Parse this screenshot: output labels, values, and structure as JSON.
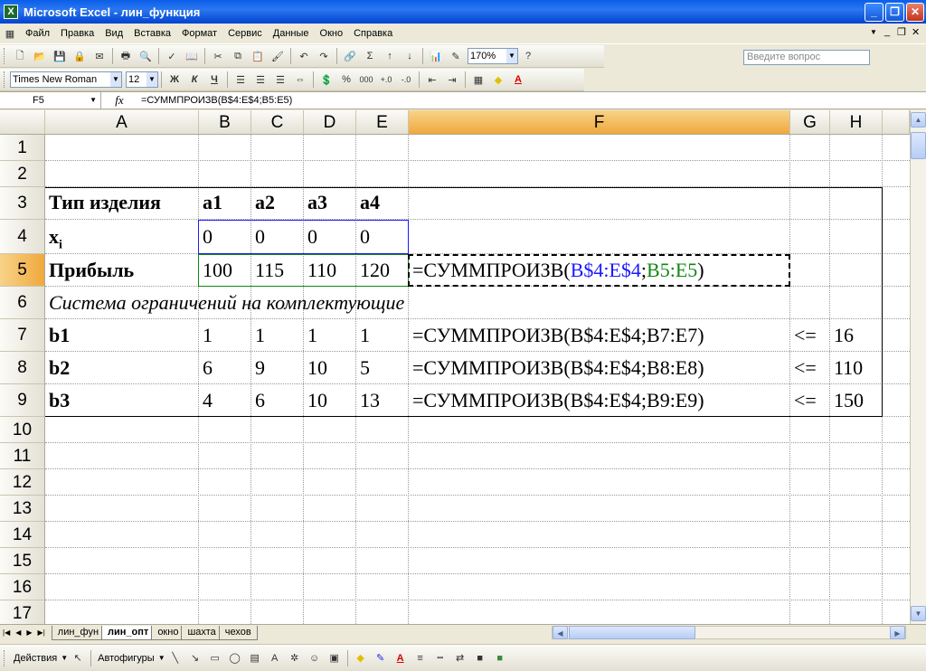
{
  "window": {
    "title": "Microsoft Excel - лин_функция",
    "logo": "X"
  },
  "menu": [
    "Файл",
    "Правка",
    "Вид",
    "Вставка",
    "Формат",
    "Сервис",
    "Данные",
    "Окно",
    "Справка"
  ],
  "ask_placeholder": "Введите вопрос",
  "standard_toolbar": {
    "zoom": "170%"
  },
  "format_toolbar": {
    "font": "Times New Roman",
    "size": "12",
    "bold": "Ж",
    "italic": "К",
    "underline": "Ч",
    "percent": "%",
    "thousands": "000"
  },
  "formula_bar": {
    "name_box": "F5",
    "fx": "fx",
    "formula": "=СУММПРОИЗВ(B$4:E$4;B5:E5)"
  },
  "columns": [
    "A",
    "B",
    "C",
    "D",
    "E",
    "F",
    "G",
    "H"
  ],
  "rows": [
    "1",
    "2",
    "3",
    "4",
    "5",
    "6",
    "7",
    "8",
    "9",
    "10",
    "11",
    "12",
    "13",
    "14",
    "15",
    "16",
    "17"
  ],
  "cells": {
    "A3": "Тип изделия",
    "B3": "a1",
    "C3": "a2",
    "D3": "a3",
    "E3": "a4",
    "A4": "x",
    "A4_sub": "i",
    "B4": "0",
    "C4": "0",
    "D4": "0",
    "E4": "0",
    "A5": "Прибыль",
    "B5": "100",
    "C5": "115",
    "D5": "110",
    "E5": "120",
    "F5_a": "=СУММПРОИЗВ(",
    "F5_b": "B$4:E$4",
    "F5_c": ";",
    "F5_d": "B5:E5",
    "F5_e": ")",
    "A6": "Система ограничений на комплектующие",
    "A7": "b1",
    "B7": "1",
    "C7": "1",
    "D7": "1",
    "E7": "1",
    "F7": "=СУММПРОИЗВ(B$4:E$4;B7:E7)",
    "G7": "<=",
    "H7": "16",
    "A8": "b2",
    "B8": "6",
    "C8": "9",
    "D8": "10",
    "E8": "5",
    "F8": "=СУММПРОИЗВ(B$4:E$4;B8:E8)",
    "G8": "<=",
    "H8": "110",
    "A9": "b3",
    "B9": "4",
    "C9": "6",
    "D9": "10",
    "E9": "13",
    "F9": "=СУММПРОИЗВ(B$4:E$4;B9:E9)",
    "G9": "<=",
    "H9": "150"
  },
  "sheet_tabs": [
    "лин_фун",
    "лин_опт",
    "окно",
    "шахта",
    "чехов"
  ],
  "active_tab": "лин_опт",
  "drawing_toolbar": {
    "actions": "Действия",
    "autoshapes": "Автофигуры"
  },
  "colors": {
    "ref1": "#1a1aff",
    "ref2": "#118811",
    "title_bar": "#0a5ee8",
    "selected_header": "#f0a83c"
  }
}
